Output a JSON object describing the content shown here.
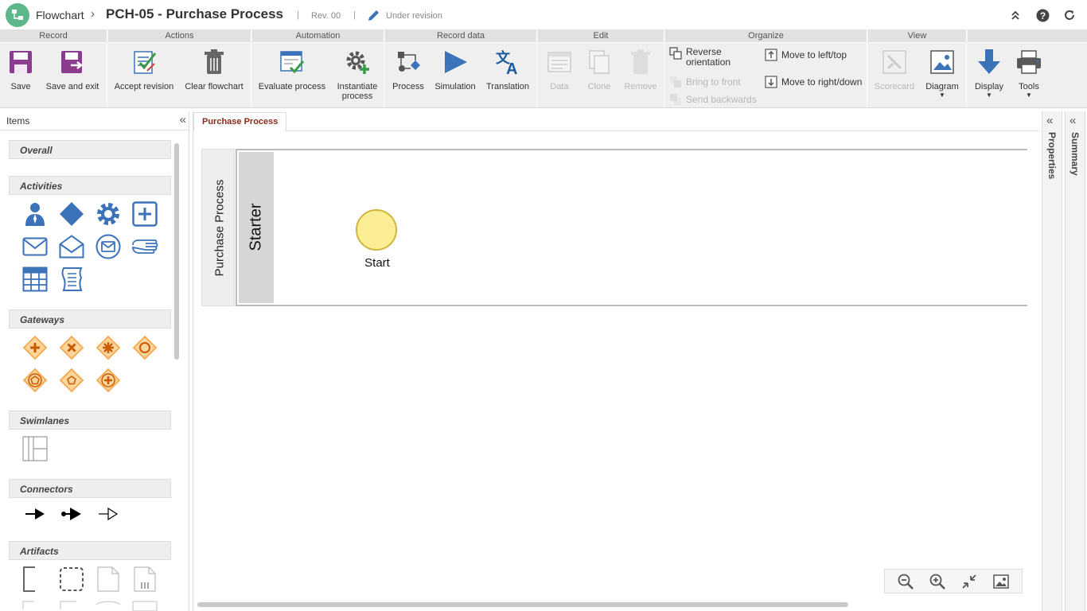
{
  "titlebar": {
    "logo_icon": "flowchart-logo-icon",
    "crumb": "Flowchart",
    "title": "PCH-05 - Purchase Process",
    "revision": "Rev. 00",
    "status": "Under revision",
    "status_icon": "pencil-icon",
    "right_icons": [
      "collapse-up-icon",
      "help-icon",
      "refresh-icon"
    ]
  },
  "ribbon": {
    "groups": {
      "record": "Record",
      "actions": "Actions",
      "automation": "Automation",
      "record_data": "Record data",
      "edit": "Edit",
      "organize": "Organize",
      "view": "View"
    },
    "buttons": {
      "save": "Save",
      "save_exit": "Save and exit",
      "accept_revision": "Accept revision",
      "clear_flowchart": "Clear flowchart",
      "evaluate_process": "Evaluate process",
      "instantiate_process": "Instantiate process",
      "process": "Process",
      "simulation": "Simulation",
      "translation": "Translation",
      "data": "Data",
      "clone": "Clone",
      "remove": "Remove",
      "reverse_orientation": "Reverse orientation",
      "bring_to_front": "Bring to front",
      "send_backwards": "Send backwards",
      "move_left_top": "Move to left/top",
      "move_right_down": "Move to right/down",
      "scorecard": "Scorecard",
      "diagram": "Diagram",
      "display": "Display",
      "tools": "Tools"
    }
  },
  "items_panel": {
    "title": "Items",
    "sections": {
      "overall": "Overall",
      "activities": "Activities",
      "gateways": "Gateways",
      "swimlanes": "Swimlanes",
      "connectors": "Connectors",
      "artifacts": "Artifacts"
    },
    "activity_icons": [
      "user-task-icon",
      "diamond-icon",
      "service-task-icon",
      "subprocess-icon",
      "message-icon",
      "open-message-icon",
      "message-event-icon",
      "manual-task-icon",
      "table-icon",
      "script-icon"
    ],
    "gateway_icons": [
      "parallel-gateway-icon",
      "exclusive-gateway-icon",
      "complex-gateway-icon",
      "inclusive-gateway-icon",
      "event-gateway-icon",
      "exclusive-event-gateway-icon",
      "parallel-event-gateway-icon"
    ],
    "connector_icons": [
      "sequence-flow-icon",
      "conditional-flow-icon",
      "default-flow-icon"
    ],
    "artifact_icons": [
      "annotation-icon",
      "group-icon",
      "data-object-icon",
      "data-collection-icon"
    ]
  },
  "canvas": {
    "tab": "Purchase Process",
    "pool_label": "Purchase Process",
    "lane_label": "Starter",
    "start_event_label": "Start",
    "zoom_icons": [
      "zoom-out-icon",
      "zoom-in-icon",
      "fit-icon",
      "export-image-icon"
    ]
  },
  "side_panels": {
    "properties": "Properties",
    "summary": "Summary"
  },
  "colors": {
    "accent_blue": "#3b72b8",
    "gateway_orange": "#f4a94e",
    "start_fill": "#fbee95",
    "tab_text": "#8a2b1a"
  }
}
